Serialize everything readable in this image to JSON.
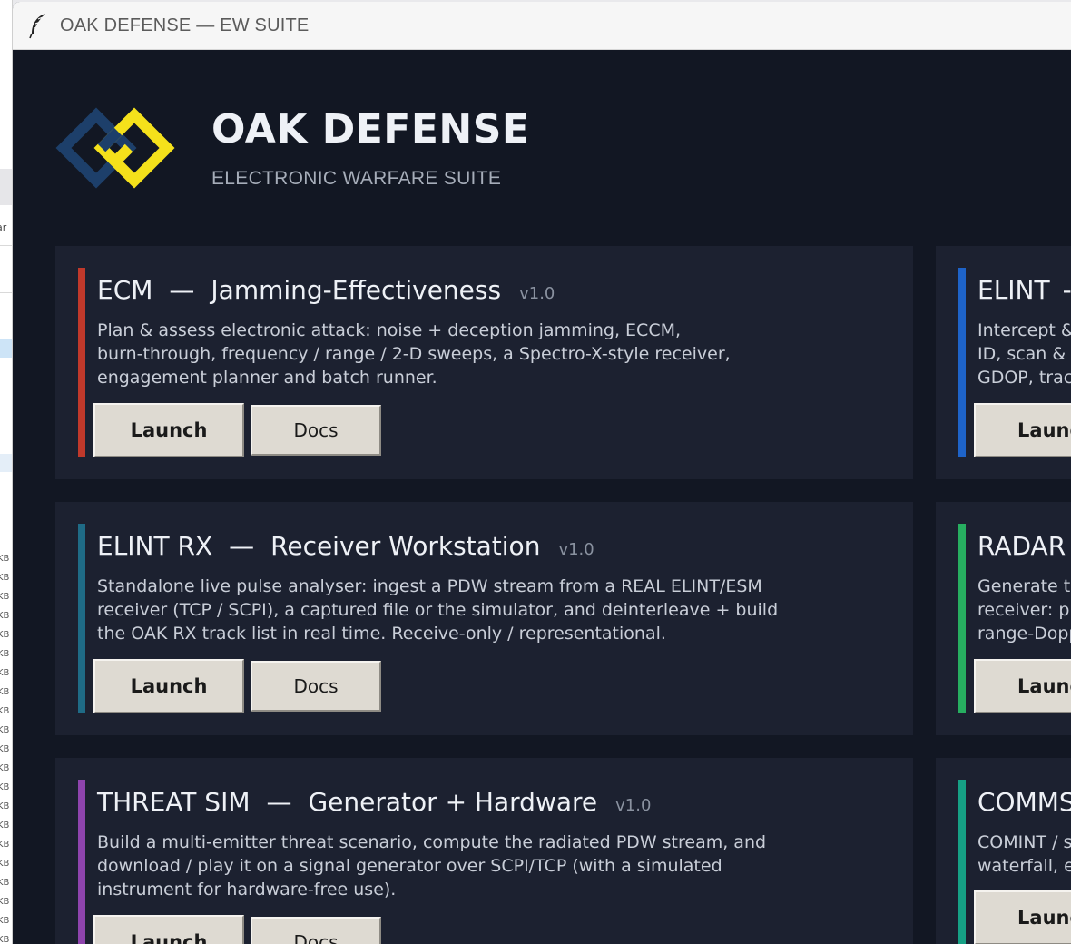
{
  "background_window": {
    "fragment": "ar",
    "size_labels": [
      "KB",
      "KB",
      "KB",
      "KB",
      "KB",
      "KB",
      "KB",
      "KB",
      "KB",
      "KB",
      "KB",
      "KB",
      "KB",
      "KB",
      "KB",
      "KB",
      "KB",
      "KB",
      "KB",
      "KB",
      "KB",
      "KB"
    ]
  },
  "window": {
    "title": "OAK DEFENSE — EW SUITE",
    "icon": "feather-icon"
  },
  "header": {
    "brand": "OAK DEFENSE",
    "subtitle": "ELECTRONIC WARFARE SUITE",
    "logo": "oak-defense-logo",
    "logo_colors": [
      "#1d3f6a",
      "#f5e11b"
    ]
  },
  "colors": {
    "background": "#121723",
    "card": "#1c2130",
    "button": "#dedad2"
  },
  "cards": [
    {
      "name": "ECM",
      "subtitle": "Jamming-Effectiveness",
      "version": "v1.0",
      "accent": "#c0392b",
      "description": "Plan & assess electronic attack: noise + deception jamming, ECCM,\nburn-through, frequency / range / 2-D sweeps, a Spectro-X-style receiver,\nengagement planner and batch runner.",
      "launch_label": "Launch",
      "docs_label": "Docs"
    },
    {
      "name": "ELINT RX",
      "subtitle": "Receiver Workstation",
      "version": "v1.0",
      "accent": "#1f6b86",
      "description": "Standalone live pulse analyser: ingest a PDW stream from a REAL ELINT/ESM\nreceiver (TCP / SCPI), a captured file or the simulator, and deinterleave + build\nthe OAK RX track list in real time. Receive-only / representational.",
      "launch_label": "Launch",
      "docs_label": "Docs"
    },
    {
      "name": "THREAT SIM",
      "subtitle": "Generator + Hardware",
      "version": "v1.0",
      "accent": "#8e44ad",
      "description": "Build a multi-emitter threat scenario, compute the radiated PDW stream, and\ndownload / play it on a signal generator over SCPI/TCP (with a simulated\ninstrument for hardware-free use).",
      "launch_label": "Launch",
      "docs_label": "Docs"
    }
  ],
  "right_cards": [
    {
      "name": "ELINT",
      "dash": "-",
      "accent": "#1e63c8",
      "description": "Intercept &\nID, scan & i\nGDOP, track",
      "launch_label": "Launc"
    },
    {
      "name": "RADAR",
      "accent": "#27ae60",
      "description": "Generate ta\nreceiver: pu\nrange-Dopp",
      "launch_label": "Launc"
    },
    {
      "name": "COMMS",
      "accent": "#16a085",
      "description": "COMINT / s\nwaterfall, er",
      "launch_label": "Launc"
    }
  ]
}
